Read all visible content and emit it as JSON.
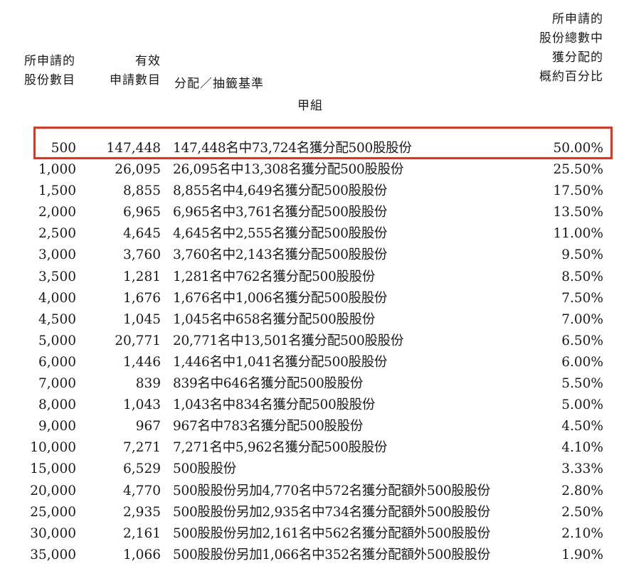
{
  "headers": {
    "col1": [
      "所申請的",
      "股份數目"
    ],
    "col2": [
      "有效",
      "申請數目"
    ],
    "col3": "分配／抽籤基準",
    "col4": [
      "所申請的",
      "股份總數中",
      "獲分配的",
      "概約百分比"
    ],
    "group": "甲組"
  },
  "highlight_color": "#e8321f",
  "rows": [
    {
      "shares": "500",
      "applications": "147,448",
      "basis": "147,448名中73,724名獲分配500股股份",
      "percent": "50.00%"
    },
    {
      "shares": "1,000",
      "applications": "26,095",
      "basis": "26,095名中13,308名獲分配500股股份",
      "percent": "25.50%"
    },
    {
      "shares": "1,500",
      "applications": "8,855",
      "basis": "8,855名中4,649名獲分配500股股份",
      "percent": "17.50%"
    },
    {
      "shares": "2,000",
      "applications": "6,965",
      "basis": "6,965名中3,761名獲分配500股股份",
      "percent": "13.50%"
    },
    {
      "shares": "2,500",
      "applications": "4,645",
      "basis": "4,645名中2,555名獲分配500股股份",
      "percent": "11.00%"
    },
    {
      "shares": "3,000",
      "applications": "3,760",
      "basis": "3,760名中2,143名獲分配500股股份",
      "percent": "9.50%"
    },
    {
      "shares": "3,500",
      "applications": "1,281",
      "basis": "1,281名中762名獲分配500股股份",
      "percent": "8.50%"
    },
    {
      "shares": "4,000",
      "applications": "1,676",
      "basis": "1,676名中1,006名獲分配500股股份",
      "percent": "7.50%"
    },
    {
      "shares": "4,500",
      "applications": "1,045",
      "basis": "1,045名中658名獲分配500股股份",
      "percent": "7.00%"
    },
    {
      "shares": "5,000",
      "applications": "20,771",
      "basis": "20,771名中13,501名獲分配500股股份",
      "percent": "6.50%"
    },
    {
      "shares": "6,000",
      "applications": "1,446",
      "basis": "1,446名中1,041名獲分配500股股份",
      "percent": "6.00%"
    },
    {
      "shares": "7,000",
      "applications": "839",
      "basis": "839名中646名獲分配500股股份",
      "percent": "5.50%"
    },
    {
      "shares": "8,000",
      "applications": "1,043",
      "basis": "1,043名中834名獲分配500股股份",
      "percent": "5.00%"
    },
    {
      "shares": "9,000",
      "applications": "967",
      "basis": "967名中783名獲分配500股股份",
      "percent": "4.50%"
    },
    {
      "shares": "10,000",
      "applications": "7,271",
      "basis": "7,271名中5,962名獲分配500股股份",
      "percent": "4.10%"
    },
    {
      "shares": "15,000",
      "applications": "6,529",
      "basis": "500股股份",
      "percent": "3.33%"
    },
    {
      "shares": "20,000",
      "applications": "4,770",
      "basis": "500股股份另加4,770名中572名獲分配額外500股股份",
      "percent": "2.80%"
    },
    {
      "shares": "25,000",
      "applications": "2,935",
      "basis": "500股股份另加2,935名中734名獲分配額外500股股份",
      "percent": "2.50%"
    },
    {
      "shares": "30,000",
      "applications": "2,161",
      "basis": "500股股份另加2,161名中562名獲分配額外500股股份",
      "percent": "2.10%"
    },
    {
      "shares": "35,000",
      "applications": "1,066",
      "basis": "500股股份另加1,066名中352名獲分配額外500股股份",
      "percent": "1.90%"
    }
  ]
}
